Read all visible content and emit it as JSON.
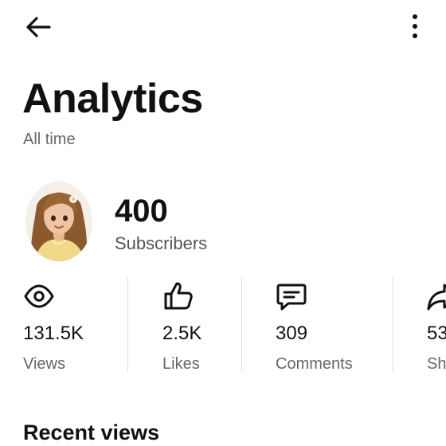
{
  "header": {
    "title": "Analytics",
    "subtitle": "All time",
    "icons": {
      "back": "arrow-left-icon",
      "more": "more-vertical-icon"
    }
  },
  "subscribers": {
    "count": "400",
    "label": "Subscribers"
  },
  "stats": [
    {
      "icon": "eye-icon",
      "value": "131.5K",
      "label": "Views"
    },
    {
      "icon": "thumbs-up-icon",
      "value": "2.5K",
      "label": "Likes"
    },
    {
      "icon": "comment-icon",
      "value": "309",
      "label": "Comments"
    },
    {
      "icon": "share-icon",
      "value": "53",
      "label": "Sh"
    }
  ],
  "sections": {
    "recent_views": "Recent views"
  },
  "colors": {
    "text": "#111111",
    "muted": "#666666",
    "divider": "#dedede"
  }
}
